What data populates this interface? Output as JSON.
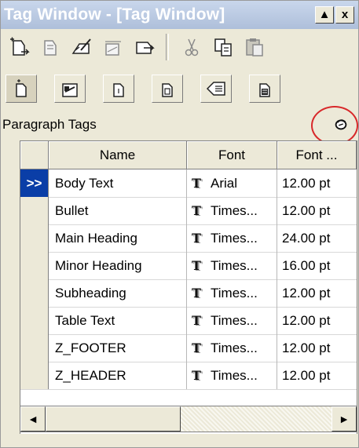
{
  "window": {
    "title": "Tag Window - [Tag Window]",
    "minimize_glyph": "▲",
    "close_glyph": "x"
  },
  "toolbar_main": {
    "items": [
      {
        "name": "new-tag-icon"
      },
      {
        "name": "modify-tag-icon"
      },
      {
        "name": "edit-tag-icon"
      },
      {
        "name": "xyz-tag-icon"
      },
      {
        "name": "apply-tag-icon"
      },
      {
        "name": "cut-icon"
      },
      {
        "name": "copy-icon"
      },
      {
        "name": "paste-icon"
      }
    ]
  },
  "toolbar_tabs": {
    "items": [
      {
        "name": "paragraph-tags-tab"
      },
      {
        "name": "character-tags-tab"
      },
      {
        "name": "section-tags-tab"
      },
      {
        "name": "table-tags-tab"
      },
      {
        "name": "field-tags-tab"
      },
      {
        "name": "page-tags-tab"
      }
    ]
  },
  "group": {
    "label": "Paragraph Tags"
  },
  "table": {
    "columns": [
      "Name",
      "Font",
      "Font ..."
    ],
    "selected_marker": ">>",
    "rows": [
      {
        "name": "Body Text",
        "font": "Arial",
        "size": "12.00 pt",
        "selected": true
      },
      {
        "name": "Bullet",
        "font": "Times...",
        "size": "12.00 pt"
      },
      {
        "name": "Main Heading",
        "font": "Times...",
        "size": "24.00 pt"
      },
      {
        "name": "Minor Heading",
        "font": "Times...",
        "size": "16.00 pt"
      },
      {
        "name": "Subheading",
        "font": "Times...",
        "size": "12.00 pt"
      },
      {
        "name": "Table Text",
        "font": "Times...",
        "size": "12.00 pt"
      },
      {
        "name": "Z_FOOTER",
        "font": "Times...",
        "size": "12.00 pt"
      },
      {
        "name": "Z_HEADER",
        "font": "Times...",
        "size": "12.00 pt"
      }
    ]
  },
  "font_glyph": "T",
  "scroll": {
    "left_glyph": "◄",
    "right_glyph": "►"
  },
  "colors": {
    "selection": "#0a3ea7",
    "highlight_ring": "#d8282a"
  }
}
